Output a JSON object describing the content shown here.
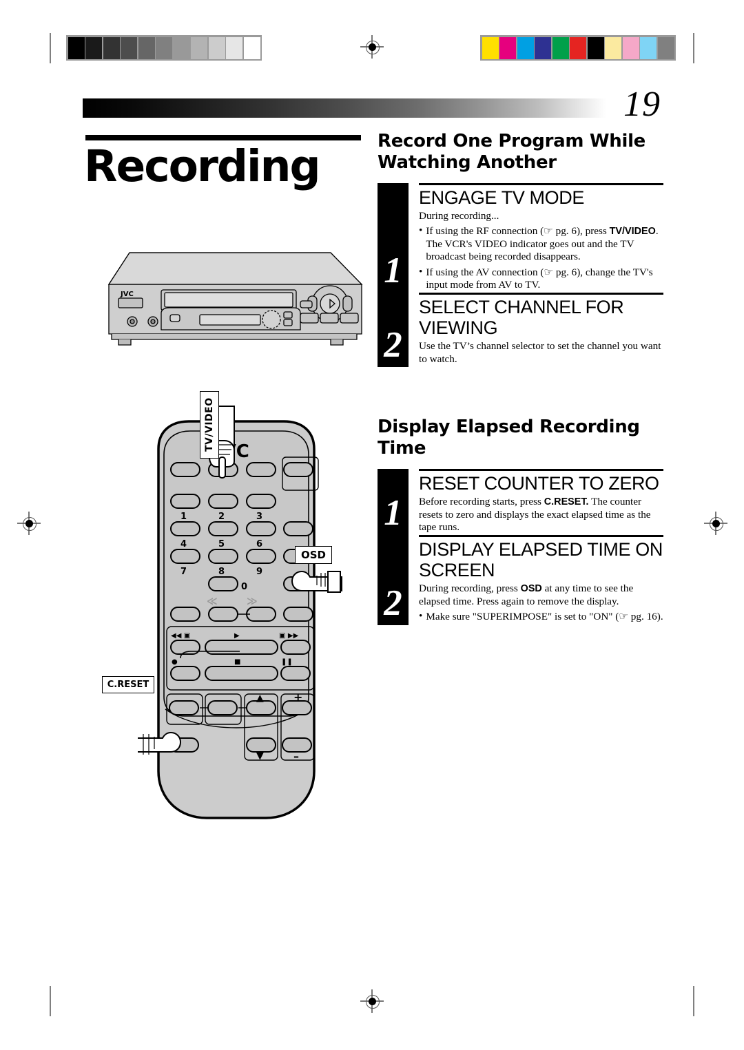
{
  "page": {
    "number": "19"
  },
  "print_marks": {
    "gray_wedge": [
      "#000000",
      "#1a1a1a",
      "#333333",
      "#4d4d4d",
      "#666666",
      "#808080",
      "#999999",
      "#b3b3b3",
      "#cccccc",
      "#e6e6e6",
      "#ffffff"
    ],
    "color_bars": [
      "#ffe000",
      "#e6007e",
      "#00a0e3",
      "#2e3192",
      "#00a04a",
      "#e52421",
      "#000000",
      "#fbeaa0",
      "#f5a8c8",
      "#7fd4f5",
      "#808080"
    ]
  },
  "chapter": {
    "title": "Recording"
  },
  "illustrations": {
    "vcr": {
      "brand": "JVC"
    },
    "remote": {
      "brand": "JVC",
      "keypad": [
        "1",
        "2",
        "3",
        "4",
        "5",
        "6",
        "7",
        "8",
        "9",
        "0"
      ],
      "transport": {
        "rewind": "◀◀",
        "play": "▶",
        "forward": "▶▶",
        "record": "●",
        "stop": "■",
        "pause": "❚❚"
      },
      "channel": {
        "up": "▲",
        "down": "▼"
      },
      "volume": {
        "up": "+",
        "down": "–"
      },
      "shuttle": {
        "left": "≪",
        "right": "≫"
      }
    },
    "callouts": {
      "tv_video": "TV/VIDEO",
      "osd": "OSD",
      "c_reset": "C.RESET"
    }
  },
  "sections": [
    {
      "heading": "Record One Program While Watching Another",
      "steps": [
        {
          "number": "1",
          "title": "ENGAGE TV MODE",
          "intro": "During recording...",
          "bullets": [
            {
              "pre": "If using the RF connection (",
              "hand": "☞",
              "mid": " pg. 6), press ",
              "bold": "TV/VIDEO",
              "post": ". The VCR's VIDEO indicator goes out and the TV broadcast being recorded disappears."
            },
            {
              "pre": "If using the AV connection (",
              "hand": "☞",
              "mid": " pg. 6), change the TV's input mode from AV to TV.",
              "bold": "",
              "post": ""
            }
          ]
        },
        {
          "number": "2",
          "title": "SELECT CHANNEL FOR VIEWING",
          "intro": "Use the TV’s channel selector to set the channel you want to watch.",
          "bullets": []
        }
      ]
    },
    {
      "heading": "Display Elapsed Recording Time",
      "steps": [
        {
          "number": "1",
          "title": "RESET COUNTER TO ZERO",
          "intro": "Before recording starts, press C.RESET. The counter resets to zero and displays the exact elapsed time as the tape runs.",
          "intro_bold": "C.RESET.",
          "bullets": []
        },
        {
          "number": "2",
          "title": "DISPLAY ELAPSED TIME ON SCREEN",
          "intro": "During recording, press OSD at any time to see the elapsed time. Press again to remove the display.",
          "intro_bold": "OSD",
          "bullets": [
            {
              "pre": "Make sure \"SUPERIMPOSE\" is set to \"ON\" (",
              "hand": "☞",
              "mid": " pg. 16).",
              "bold": "",
              "post": ""
            }
          ]
        }
      ]
    }
  ]
}
